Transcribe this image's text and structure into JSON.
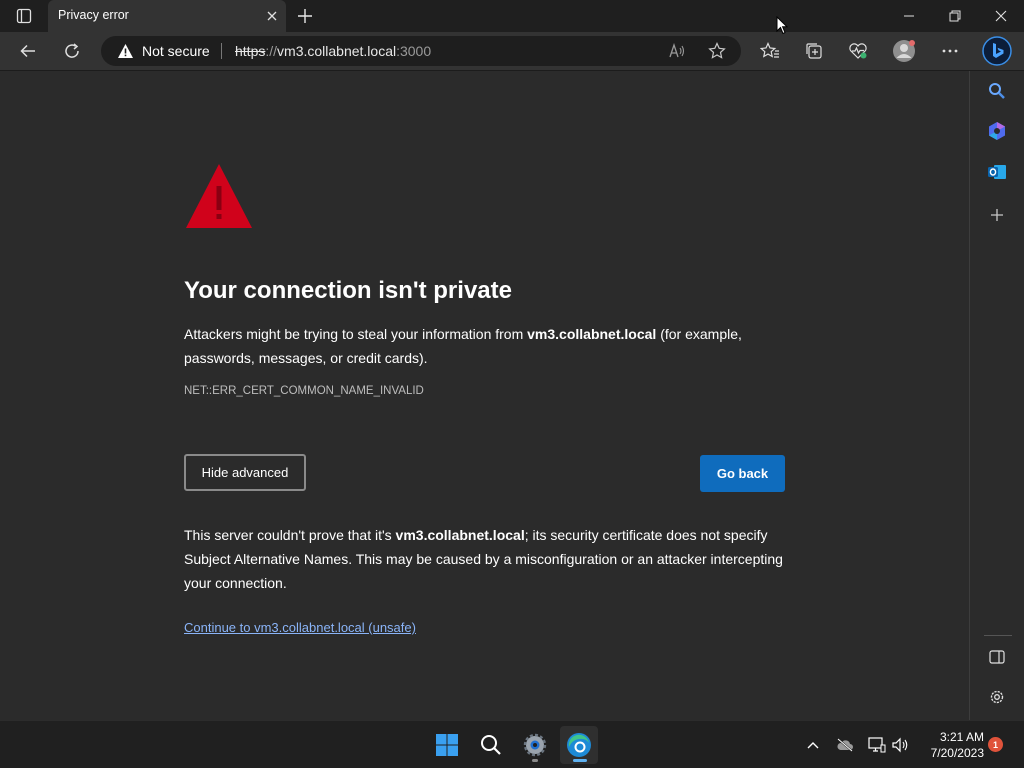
{
  "browser": {
    "tab_title": "Privacy error",
    "address": {
      "security_label": "Not secure",
      "url_scheme": "https",
      "url_sep": "://",
      "url_host": "vm3.collabnet.local",
      "url_port": ":3000"
    }
  },
  "page": {
    "heading": "Your connection isn't private",
    "intro_before": "Attackers might be trying to steal your information from ",
    "intro_host": "vm3.collabnet.local",
    "intro_after": " (for example, passwords, messages, or credit cards).",
    "error_code": "NET::ERR_CERT_COMMON_NAME_INVALID",
    "hide_advanced_label": "Hide advanced",
    "go_back_label": "Go back",
    "details_before": "This server couldn't prove that it's ",
    "details_host": "vm3.collabnet.local",
    "details_after": "; its security certificate does not specify Subject Alternative Names. This may be caused by a misconfiguration or an attacker intercepting your connection.",
    "continue_link": "Continue to vm3.collabnet.local (unsafe)"
  },
  "taskbar": {
    "time": "3:21 AM",
    "date": "7/20/2023",
    "notification_count": "1"
  },
  "colors": {
    "page_bg": "#2b2b2b",
    "warning_red": "#d0021b",
    "primary_button": "#0f6cbd",
    "link": "#8ab4f8"
  },
  "icons": [
    "tab-actions-icon",
    "close-icon",
    "plus-icon",
    "minimize-icon",
    "restore-icon",
    "back-icon",
    "refresh-icon",
    "warning-icon",
    "read-aloud-icon",
    "star-icon",
    "favorites-icon",
    "collections-icon",
    "health-icon",
    "profile-icon",
    "more-icon",
    "bing-icon",
    "search-icon",
    "copilot-icon",
    "outlook-icon",
    "sidebar-toggle-icon",
    "settings-icon",
    "windows-start-icon",
    "edge-icon",
    "chevron-up-icon",
    "cloud-off-icon",
    "network-icon",
    "volume-icon"
  ]
}
